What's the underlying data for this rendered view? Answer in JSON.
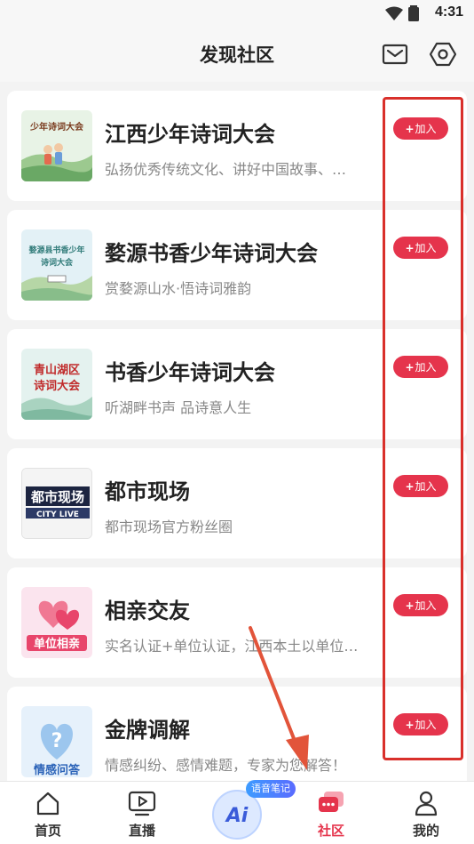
{
  "status_bar": {
    "time": "4:31"
  },
  "header": {
    "title": "发现社区"
  },
  "communities": [
    {
      "title": "江西少年诗词大会",
      "description": "弘扬优秀传统文化、讲好中国故事、…",
      "join_label": "加入",
      "thumb": {
        "caption": "少年诗词大会",
        "bg": "#e8f3e6",
        "accent": "#3f8c4a"
      }
    },
    {
      "title": "婺源书香少年诗词大会",
      "description": "赏婺源山水·悟诗词雅韵",
      "join_label": "加入",
      "thumb": {
        "caption": "婺源县书香少年诗词大会",
        "bg": "#e3f1f6",
        "accent": "#2f7a78"
      }
    },
    {
      "title": "书香少年诗词大会",
      "description": "听湖畔书声 品诗意人生",
      "join_label": "加入",
      "thumb": {
        "caption": "青山湖区诗词大会",
        "bg": "#e4f2ef",
        "accent": "#c02a2a"
      }
    },
    {
      "title": "都市现场",
      "description": "都市现场官方粉丝圈",
      "join_label": "加入",
      "thumb": {
        "caption": "都市现场 CITY LIVE",
        "bg": "#f4f4f4",
        "accent": "#1c2440"
      }
    },
    {
      "title": "相亲交友",
      "description": "实名认证+单位认证，江西本土以单位…",
      "join_label": "加入",
      "thumb": {
        "caption": "单位相亲",
        "bg": "#fbe4ee",
        "accent": "#e8456b"
      }
    },
    {
      "title": "金牌调解",
      "description": "情感纠纷、感情难题，专家为您解答！",
      "join_label": "加入",
      "thumb": {
        "caption": "情感问答",
        "bg": "#e6f1fb",
        "accent": "#2b63b8"
      }
    }
  ],
  "tabbar": {
    "items": [
      {
        "label": "首页",
        "icon": "home-icon"
      },
      {
        "label": "直播",
        "icon": "tv-icon"
      },
      {
        "label": "社区",
        "icon": "community-icon",
        "active": true
      },
      {
        "label": "我的",
        "icon": "user-icon"
      }
    ],
    "ai": {
      "badge": "语音笔记",
      "label": "Ai"
    }
  },
  "colors": {
    "accent": "#e5344c",
    "highlight": "#d9302b",
    "background": "#f3f3f3"
  }
}
